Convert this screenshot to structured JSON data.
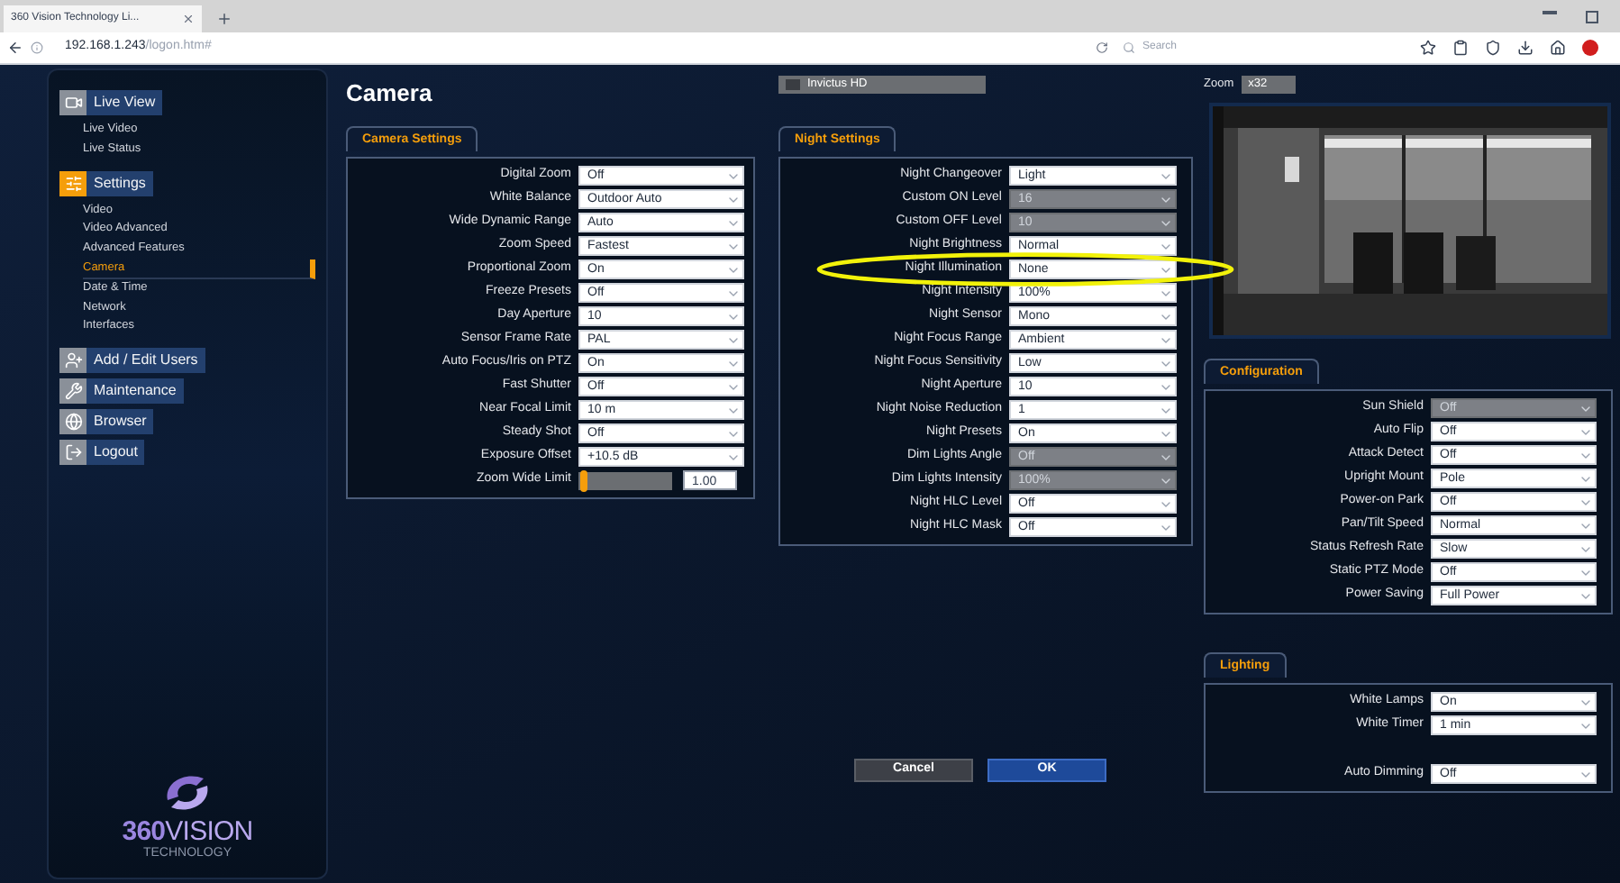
{
  "browser": {
    "tab_title": "360 Vision Technology Li...",
    "url_host": "192.168.1.243",
    "url_path": "/logon.htm#",
    "search_placeholder": "Search"
  },
  "sidebar": {
    "sections": [
      {
        "label": "Live View",
        "selected": false,
        "children": [
          {
            "label": "Live Video",
            "selected": false
          },
          {
            "label": "Live Status",
            "selected": false
          }
        ]
      },
      {
        "label": "Settings",
        "selected": true,
        "children": [
          {
            "label": "Video",
            "selected": false
          },
          {
            "label": "Video Advanced",
            "selected": false
          },
          {
            "label": "Advanced Features",
            "selected": false
          },
          {
            "label": "Camera",
            "selected": true
          },
          {
            "label": "Date & Time",
            "selected": false
          },
          {
            "label": "Network",
            "selected": false
          },
          {
            "label": "Interfaces",
            "selected": false
          }
        ]
      },
      {
        "label": "Add / Edit Users",
        "selected": false
      },
      {
        "label": "Maintenance",
        "selected": false
      },
      {
        "label": "Browser",
        "selected": false
      },
      {
        "label": "Logout",
        "selected": false
      }
    ],
    "logo": {
      "brand_bold": "360",
      "brand": "VISION",
      "tagline": "TECHNOLOGY"
    }
  },
  "page_title": "Camera",
  "camera_model": "Invictus HD",
  "zoom": {
    "label": "Zoom",
    "value": "x32"
  },
  "camera_settings": {
    "title": "Camera Settings",
    "rows": [
      {
        "label": "Digital Zoom",
        "value": "Off",
        "disabled": false,
        "kind": "select"
      },
      {
        "label": "White Balance",
        "value": "Outdoor Auto",
        "disabled": false,
        "kind": "select"
      },
      {
        "label": "Wide Dynamic Range",
        "value": "Auto",
        "disabled": false,
        "kind": "select"
      },
      {
        "label": "Zoom Speed",
        "value": "Fastest",
        "disabled": false,
        "kind": "select"
      },
      {
        "label": "Proportional Zoom",
        "value": "On",
        "disabled": false,
        "kind": "select"
      },
      {
        "label": "Freeze Presets",
        "value": "Off",
        "disabled": false,
        "kind": "select"
      },
      {
        "label": "Day Aperture",
        "value": "10",
        "disabled": false,
        "kind": "select"
      },
      {
        "label": "Sensor Frame Rate",
        "value": "PAL",
        "disabled": false,
        "kind": "select"
      },
      {
        "label": "Auto Focus/Iris on PTZ",
        "value": "On",
        "disabled": false,
        "kind": "select"
      },
      {
        "label": "Fast Shutter",
        "value": "Off",
        "disabled": false,
        "kind": "select"
      },
      {
        "label": "Near Focal Limit",
        "value": "10 m",
        "disabled": false,
        "kind": "select"
      },
      {
        "label": "Steady Shot",
        "value": "Off",
        "disabled": false,
        "kind": "select"
      },
      {
        "label": "Exposure Offset",
        "value": "+10.5 dB",
        "disabled": false,
        "kind": "select"
      },
      {
        "label": "Zoom Wide Limit",
        "value": "1.00",
        "level": 0.02,
        "kind": "slider"
      }
    ]
  },
  "night_settings": {
    "title": "Night Settings",
    "rows": [
      {
        "label": "Night Changeover",
        "value": "Light",
        "disabled": false,
        "kind": "select"
      },
      {
        "label": "Custom ON Level",
        "value": "16",
        "disabled": true,
        "kind": "select"
      },
      {
        "label": "Custom OFF Level",
        "value": "10",
        "disabled": true,
        "kind": "select"
      },
      {
        "label": "Night Brightness",
        "value": "Normal",
        "disabled": false,
        "kind": "select"
      },
      {
        "label": "Night Illumination",
        "value": "None",
        "disabled": false,
        "kind": "select",
        "highlighted": true
      },
      {
        "label": "Night Intensity",
        "value": "100%",
        "disabled": false,
        "kind": "select"
      },
      {
        "label": "Night Sensor",
        "value": "Mono",
        "disabled": false,
        "kind": "select"
      },
      {
        "label": "Night Focus Range",
        "value": "Ambient",
        "disabled": false,
        "kind": "select"
      },
      {
        "label": "Night Focus Sensitivity",
        "value": "Low",
        "disabled": false,
        "kind": "select"
      },
      {
        "label": "Night Aperture",
        "value": "10",
        "disabled": false,
        "kind": "select"
      },
      {
        "label": "Night Noise Reduction",
        "value": "1",
        "disabled": false,
        "kind": "select"
      },
      {
        "label": "Night Presets",
        "value": "On",
        "disabled": false,
        "kind": "select"
      },
      {
        "label": "Dim Lights Angle",
        "value": "Off",
        "disabled": true,
        "kind": "select"
      },
      {
        "label": "Dim Lights Intensity",
        "value": "100%",
        "disabled": true,
        "kind": "select"
      },
      {
        "label": "Night HLC Level",
        "value": "Off",
        "disabled": false,
        "kind": "select"
      },
      {
        "label": "Night HLC Mask",
        "value": "Off",
        "disabled": false,
        "kind": "select"
      }
    ]
  },
  "configuration": {
    "title": "Configuration",
    "rows": [
      {
        "label": "Sun Shield",
        "value": "Off",
        "disabled": true,
        "kind": "select"
      },
      {
        "label": "Auto Flip",
        "value": "Off",
        "disabled": false,
        "kind": "select"
      },
      {
        "label": "Attack Detect",
        "value": "Off",
        "disabled": false,
        "kind": "select"
      },
      {
        "label": "Upright Mount",
        "value": "Pole",
        "disabled": false,
        "kind": "select"
      },
      {
        "label": "Power-on Park",
        "value": "Off",
        "disabled": false,
        "kind": "select"
      },
      {
        "label": "Pan/Tilt Speed",
        "value": "Normal",
        "disabled": false,
        "kind": "select"
      },
      {
        "label": "Status Refresh Rate",
        "value": "Slow",
        "disabled": false,
        "kind": "select"
      },
      {
        "label": "Static PTZ Mode",
        "value": "Off",
        "disabled": false,
        "kind": "select"
      },
      {
        "label": "Power Saving",
        "value": "Full Power",
        "disabled": false,
        "kind": "select"
      }
    ]
  },
  "lighting": {
    "title": "Lighting",
    "rows": [
      {
        "label": "White Lamps",
        "value": "On",
        "disabled": false,
        "kind": "select"
      },
      {
        "label": "White Timer",
        "value": "1 min",
        "disabled": false,
        "kind": "select"
      },
      {
        "label": "Auto Dimming",
        "value": "Off",
        "disabled": false,
        "kind": "select",
        "gap_before": true
      }
    ]
  },
  "buttons": [
    {
      "label": "Cancel",
      "kind": "secondary"
    },
    {
      "label": "OK",
      "kind": "primary"
    }
  ]
}
